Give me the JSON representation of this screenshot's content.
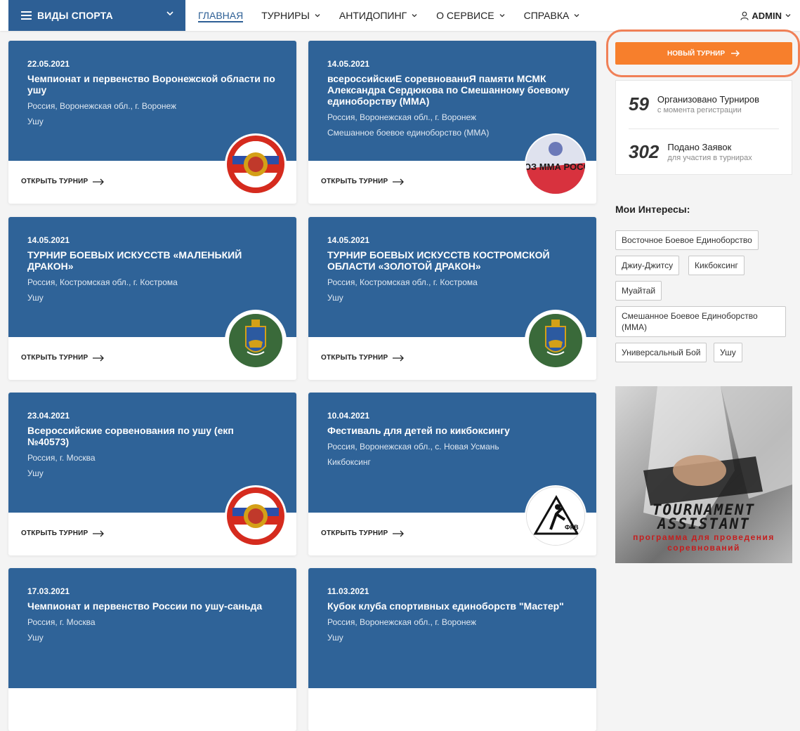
{
  "header": {
    "sports_label": "ВИДЫ СПОРТА",
    "nav": [
      {
        "label": "ГЛАВНАЯ",
        "active": true
      },
      {
        "label": "ТУРНИРЫ"
      },
      {
        "label": "АНТИДОПИНГ"
      },
      {
        "label": "О СЕРВИСЕ"
      },
      {
        "label": "СПРАВКА"
      }
    ],
    "user": "ADMIN"
  },
  "open_label": "ОТКРЫТЬ ТУРНИР",
  "cards": [
    {
      "date": "22.05.2021",
      "title": "Чемпионат и первенство Воронежской области по ушу",
      "location": "Россия, Воронежская обл., г. Воронеж",
      "sport": "Ушу",
      "logo": "russia-eagle-logo"
    },
    {
      "date": "14.05.2021",
      "title": "всероссийскиЕ соревнованиЯ памяти МСМК Александра Сердюкова по Смешанному боевому единоборству (ММА)",
      "location": "Россия, Воронежская обл., г. Воронеж",
      "sport": "Смешанное боевое единоборство (ММА)",
      "logo": "soyuz-mma-logo",
      "logo_text": "СОЮЗ ММА РОССИИ"
    },
    {
      "date": "14.05.2021",
      "title": "ТУРНИР БОЕВЫХ ИСКУССТВ «МАЛЕНЬКИЙ ДРАКОН»",
      "location": "Россия, Костромская обл., г. Кострома",
      "sport": "Ушу",
      "logo": "kostroma-coat-logo"
    },
    {
      "date": "14.05.2021",
      "title": "ТУРНИР БОЕВЫХ ИСКУССТВ КОСТРОМСКОЙ ОБЛАСТИ «ЗОЛОТОЙ ДРАКОН»",
      "location": "Россия, Костромская обл., г. Кострома",
      "sport": "Ушу",
      "logo": "kostroma-coat-logo"
    },
    {
      "date": "23.04.2021",
      "title": "Всероссийские сорвенования по ушу (екп №40573)",
      "location": "Россия, г. Москва",
      "sport": "Ушу",
      "logo": "russia-eagle-logo"
    },
    {
      "date": "10.04.2021",
      "title": "Фестиваль для детей по кикбоксингу",
      "location": "Россия, Воронежская обл., с. Новая Усмань",
      "sport": "Кикбоксинг",
      "logo": "kickboxing-logo",
      "logo_text": "ФКВ"
    },
    {
      "date": "17.03.2021",
      "title": "Чемпионат и первенство России по ушу-саньда",
      "location": "Россия, г. Москва",
      "sport": "Ушу"
    },
    {
      "date": "11.03.2021",
      "title": "Кубок клуба спортивных единоборств \"Мастер\"",
      "location": "Россия, Воронежская обл., г. Воронеж",
      "sport": "Ушу"
    }
  ],
  "sidebar": {
    "new_tournament": "НОВЫЙ ТУРНИР",
    "stats": [
      {
        "value": "59",
        "label": "Организовано Турниров",
        "sub": "с момента регистрации"
      },
      {
        "value": "302",
        "label": "Подано Заявок",
        "sub": "для участия в турнирах"
      }
    ],
    "interests_title": "Мои Интересы:",
    "interests": [
      "Восточное Боевое Единоборство",
      "Джиу-Джитсу",
      "Кикбоксинг",
      "Муайтай",
      "Смешанное Боевое Единоборство (ММА)",
      "Универсальный Бой",
      "Ушу"
    ],
    "banner": {
      "title": "TOURNAMENT ASSISTANT",
      "subtitle": "программа для проведения соревнований"
    }
  },
  "colors": {
    "primary": "#2f6398",
    "accent": "#f77f2c",
    "highlight_ring": "#f08057"
  }
}
